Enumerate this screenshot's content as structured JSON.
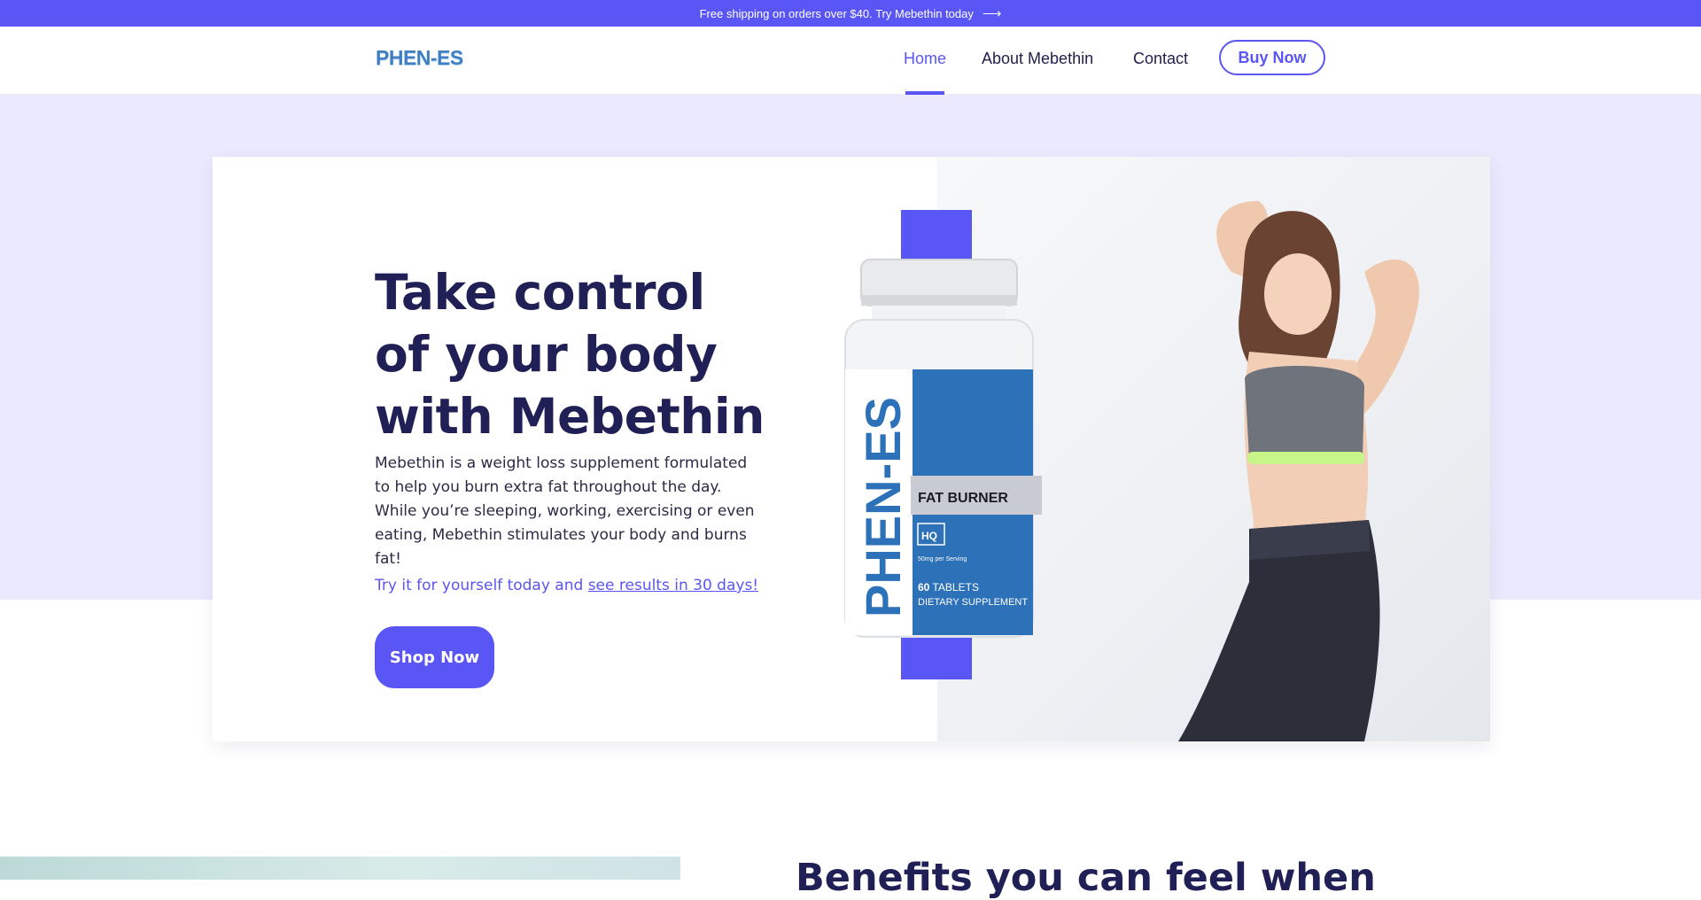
{
  "announcement": {
    "text": "Free shipping on orders over $40. Try Mebethin today",
    "arrow": "⟶"
  },
  "header": {
    "logo": "PHEN-ES",
    "nav": [
      {
        "label": "Home",
        "active": true
      },
      {
        "label": "About Mebethin",
        "active": false
      },
      {
        "label": "Contact",
        "active": false
      }
    ],
    "buy_button": "Buy Now"
  },
  "hero": {
    "headline": "Take control of your body with Mebethin",
    "description": "Mebethin is a weight loss supplement formulated to help you burn extra fat throughout the day. While you’re sleeping, working, exercising or even eating, Mebethin stimulates your body and burns fat!",
    "try_prefix": "Try it for yourself today and ",
    "try_link": "see results in 30 days!",
    "shop_button": "Shop Now",
    "product": {
      "brand": "PHEN-ES",
      "badge": "FAT BURNER",
      "hq": "HQ",
      "serving": "50mg per Serving",
      "count_number": "60",
      "count_word": "TABLETS",
      "type": "DIETARY SUPPLEMENT"
    }
  },
  "benefits": {
    "title": "Benefits you can feel when"
  },
  "colors": {
    "accent": "#5a55f5",
    "heading": "#202056",
    "hero_band": "#ebe9fd",
    "bottle_label": "#2d71b8"
  }
}
